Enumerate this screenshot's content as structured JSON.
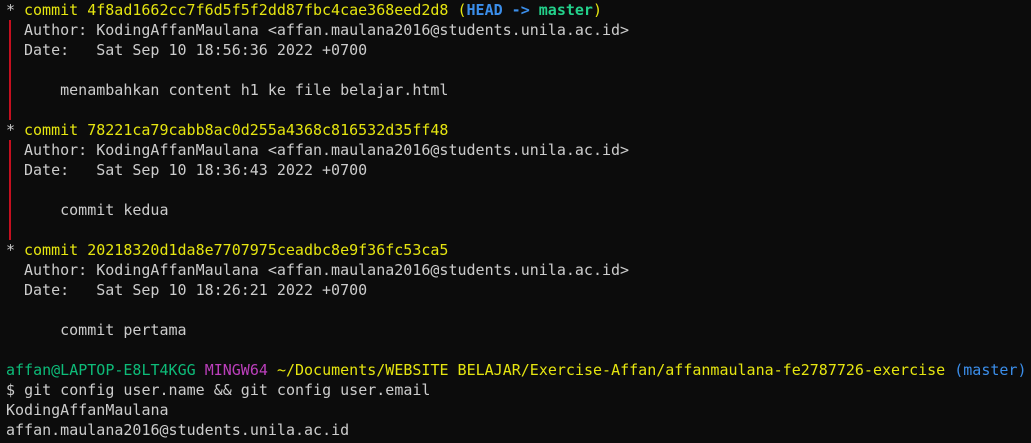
{
  "log": {
    "commits": [
      {
        "star": "*",
        "commit_word": "commit",
        "hash": "4f8ad1662cc7f6d5f5f2dd87fbc4cae368eed2d8",
        "ref_open": "(",
        "ref_head": "HEAD",
        "ref_arrow": "->",
        "ref_branch": "master",
        "ref_close": ")",
        "author_line": "Author: KodingAffanMaulana <affan.maulana2016@students.unila.ac.id>",
        "date_line": "Date:   Sat Sep 10 18:56:36 2022 +0700",
        "message": "    menambahkan content h1 ke file belajar.html"
      },
      {
        "star": "*",
        "commit_word": "commit",
        "hash": "78221ca79cabb8ac0d255a4368c816532d35ff48",
        "author_line": "Author: KodingAffanMaulana <affan.maulana2016@students.unila.ac.id>",
        "date_line": "Date:   Sat Sep 10 18:36:43 2022 +0700",
        "message": "    commit kedua"
      },
      {
        "star": "*",
        "commit_word": "commit",
        "hash": "20218320d1da8e7707975ceadbc8e9f36fc53ca5",
        "author_line": "Author: KodingAffanMaulana <affan.maulana2016@students.unila.ac.id>",
        "date_line": "Date:   Sat Sep 10 18:26:21 2022 +0700",
        "message": "    commit pertama"
      }
    ]
  },
  "prompt": {
    "user_host": "affan@LAPTOP-E8LT4KGG",
    "shell": "MINGW64",
    "path": "~/Documents/WEBSITE BELAJAR/Exercise-Affan/affanmaulana-fe2787726-exercise",
    "branch": "(master)",
    "symbol": "$",
    "command": "git config user.name && git config user.email"
  },
  "output": {
    "line1": "KodingAffanMaulana",
    "line2": "affan.maulana2016@students.unila.ac.id"
  },
  "colors": {
    "background": "#0c0c0c",
    "text": "#cccccc",
    "hash_yellow": "#e5e510",
    "graph_red": "#c50f1f",
    "head_blue": "#3b8eea",
    "branch_green": "#23d18b",
    "prompt_green": "#0dbc79",
    "shell_magenta": "#bc3fbc"
  }
}
